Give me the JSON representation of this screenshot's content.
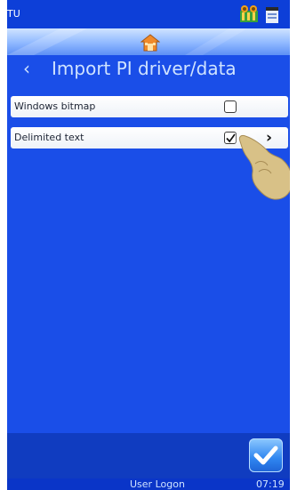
{
  "status": {
    "label": "TU"
  },
  "header": {
    "title": "Import PI driver/data",
    "back_icon": "chevron-left-icon"
  },
  "options": [
    {
      "label": "Windows bitmap",
      "checked": false
    },
    {
      "label": "Delimited text",
      "checked": true
    }
  ],
  "footer": {
    "user_label": "User Logon",
    "time": "07:19"
  },
  "colors": {
    "background": "#1a4ee8",
    "title_text": "#cfe3ff"
  }
}
